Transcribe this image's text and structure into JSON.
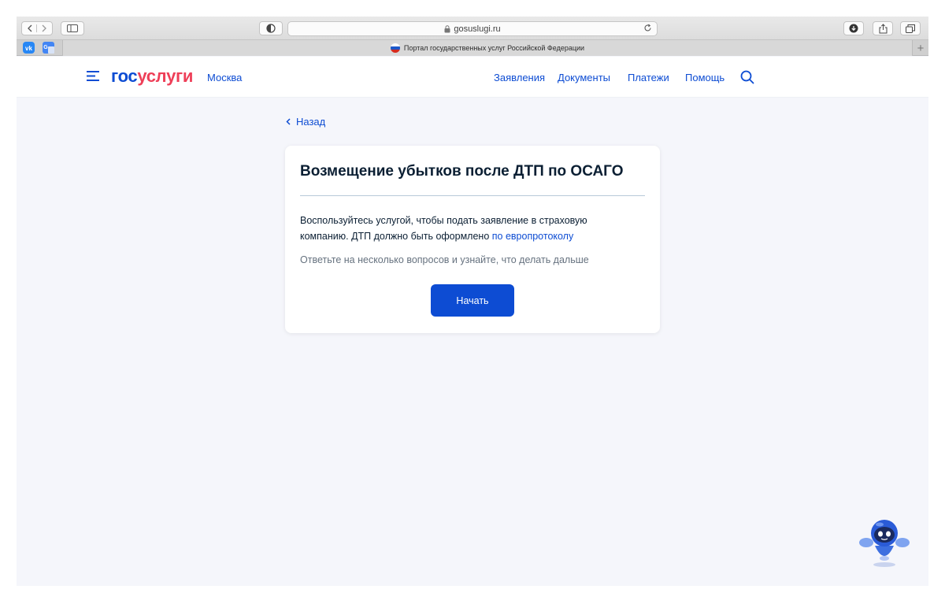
{
  "browser": {
    "url": "gosuslugi.ru",
    "tab_title": "Портал государственных услуг Российской Федерации"
  },
  "header": {
    "logo_part1": "гос",
    "logo_part2": "услуги",
    "city": "Москва",
    "nav": [
      "Заявления",
      "Документы",
      "Платежи",
      "Помощь"
    ]
  },
  "content": {
    "back_label": "Назад",
    "title": "Возмещение убытков после ДТП по ОСАГО",
    "description_line1": "Воспользуйтесь услугой, чтобы подать заявление в страховую",
    "description_line2": "компанию. ДТП должно быть оформлено ",
    "description_link": "по европротоколу",
    "hint": "Ответьте на несколько вопросов и узнайте, что делать дальше",
    "start_button": "Начать"
  },
  "colors": {
    "accent": "#0d4cd3",
    "logo_red": "#ee3f58",
    "page_bg": "#f5f6fb"
  }
}
